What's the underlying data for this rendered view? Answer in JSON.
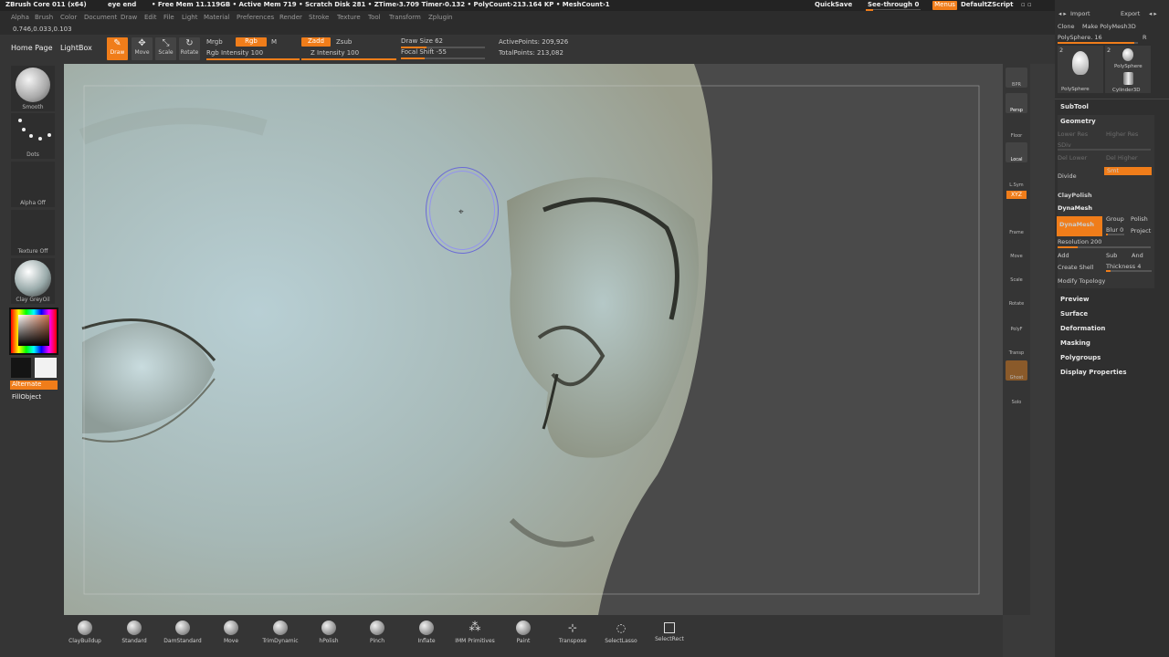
{
  "titlebar": {
    "app": "ZBrush Core 011 (x64)",
    "doc": "eye end",
    "mem": "• Free Mem 11.119GB • Active Mem 719 • Scratch Disk 281 • ZTime›3.709 Timer›0.132 • PolyCount›213.164 KP • MeshCount›1",
    "quicksave": "QuickSave",
    "seethrough": "See-through  0",
    "menus": "Menus",
    "script": "DefaultZScript"
  },
  "menubar": [
    "Alpha",
    "Brush",
    "Color",
    "Document",
    "Draw",
    "Edit",
    "File",
    "Light",
    "Material",
    "Preferences",
    "Render",
    "Stroke",
    "Texture",
    "Tool",
    "Transform",
    "Zplugin"
  ],
  "coords": "0.746,0.033,0.103",
  "toolbar": {
    "homepage": "Home Page",
    "lightbox": "LightBox",
    "draw": "Draw",
    "move": "Move",
    "scale": "Scale",
    "rotate": "Rotate",
    "mrgb": "Mrgb",
    "rgb": "Rgb",
    "m": "M",
    "rgb_intensity": "Rgb Intensity 100",
    "zadd": "Zadd",
    "zsub": "Zsub",
    "z_intensity": "Z Intensity 100",
    "draw_size": "Draw Size 62",
    "focal_shift": "Focal Shift -55",
    "active_points": "ActivePoints: 209,926",
    "total_points": "TotalPoints: 213,082"
  },
  "leftshelf": {
    "brush": "Smooth",
    "stroke": "Dots",
    "alpha": "Alpha Off",
    "texture": "Texture Off",
    "material": "Clay GreyOil",
    "alternate": "Alternate",
    "fillobject": "FillObject"
  },
  "rightshelf": [
    "BPR",
    "Persp",
    "Floor",
    "Local",
    "L.Sym",
    "Frame",
    "Move",
    "Scale",
    "Rotate",
    "PolyF",
    "Transp",
    "Ghost",
    "Solo"
  ],
  "rightshelf_xyz": "XYZ",
  "panel": {
    "import": "Import",
    "export": "Export",
    "clone": "Clone",
    "make_polymesh": "Make PolyMesh3D",
    "polysphere_slider": "PolySphere. 16",
    "r": "R",
    "thumb1_num": "2",
    "thumb1_label": "PolySphere",
    "thumb2_num": "2",
    "thumb2_label": "PolySphere",
    "thumb3_label": "Cylinder3D",
    "subtool": "SubTool",
    "geometry": "Geometry",
    "lower_res": "Lower Res",
    "higher_res": "Higher Res",
    "sdiv": "SDiv",
    "del_lower": "Del Lower",
    "del_higher": "Del Higher",
    "divide": "Divide",
    "smt": "Smt",
    "claypolish": "ClayPolish",
    "dynamesh_header": "DynaMesh",
    "dynamesh_btn": "DynaMesh",
    "group": "Group",
    "polish": "Polish",
    "blur": "Blur 0",
    "project": "Project",
    "resolution": "Resolution 200",
    "add": "Add",
    "sub": "Sub",
    "and": "And",
    "create_shell": "Create Shell",
    "thickness": "Thickness 4",
    "modify_topology": "Modify Topology",
    "sections": [
      "Preview",
      "Surface",
      "Deformation",
      "Masking",
      "Polygroups",
      "Display Properties"
    ]
  },
  "bottom_brushes": [
    "ClayBuildup",
    "Standard",
    "DamStandard",
    "Move",
    "TrimDynamic",
    "hPolish",
    "Pinch",
    "Inflate",
    "IMM Primitives",
    "Paint",
    "Transpose",
    "SelectLasso",
    "SelectRect"
  ],
  "colors": {
    "accent": "#f07d1a",
    "panel": "#2f2f2f",
    "viewport": "#4a4a4a"
  }
}
